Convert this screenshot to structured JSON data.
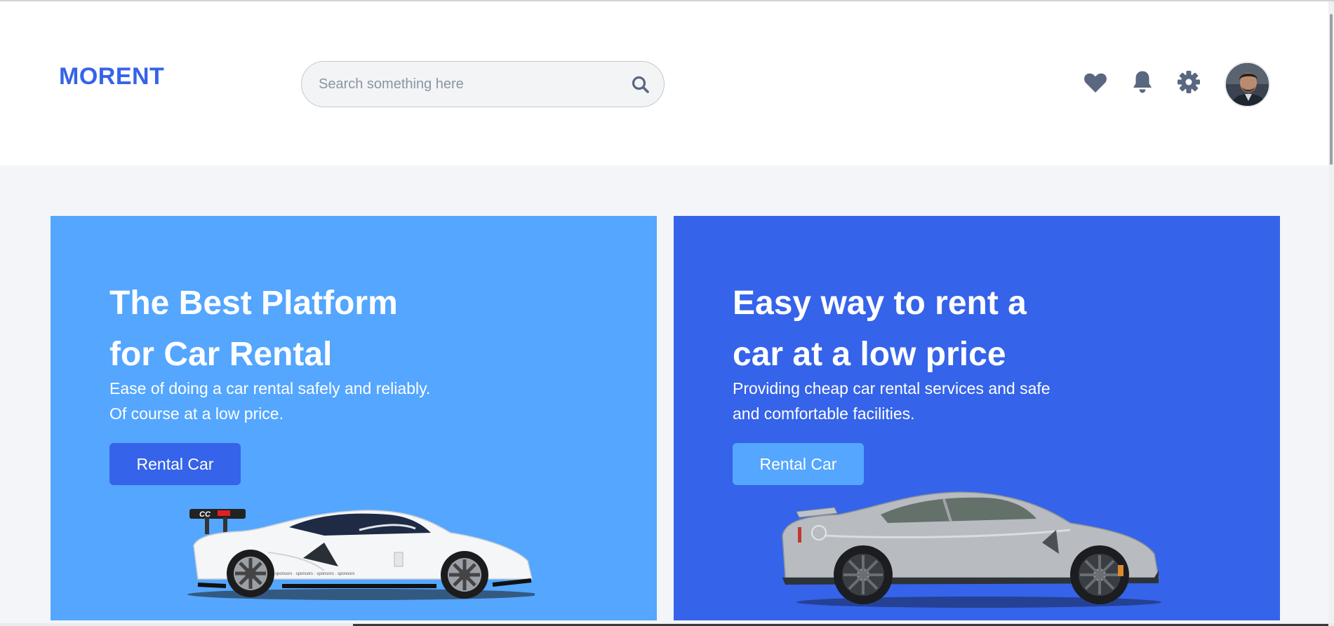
{
  "header": {
    "logo": "MORENT",
    "search": {
      "placeholder": "Search something here",
      "icon": "search-icon"
    },
    "actions": [
      {
        "name": "favorites",
        "icon": "heart-icon"
      },
      {
        "name": "notifications",
        "icon": "bell-icon"
      },
      {
        "name": "settings",
        "icon": "gear-icon"
      }
    ],
    "avatar": "avatar"
  },
  "colors": {
    "brand": "#3563e9",
    "light_blue": "#54a6ff",
    "icon": "#596780",
    "background": "#f3f5f8"
  },
  "hero": {
    "cards": [
      {
        "title_line1": "The Best Platform",
        "title_line2": "for Car Rental",
        "desc_line1": "Ease of doing a car rental safely and reliably.",
        "desc_line2": "Of course at a low price.",
        "button": "Rental Car",
        "background": "#54a6ff",
        "car": "white-sports-car"
      },
      {
        "title_line1": "Easy way to rent a",
        "title_line2": "car at a low price",
        "desc_line1": "Providing cheap car rental services and safe",
        "desc_line2": "and comfortable facilities.",
        "button": "Rental Car",
        "background": "#3563e9",
        "car": "silver-sports-car"
      }
    ]
  }
}
